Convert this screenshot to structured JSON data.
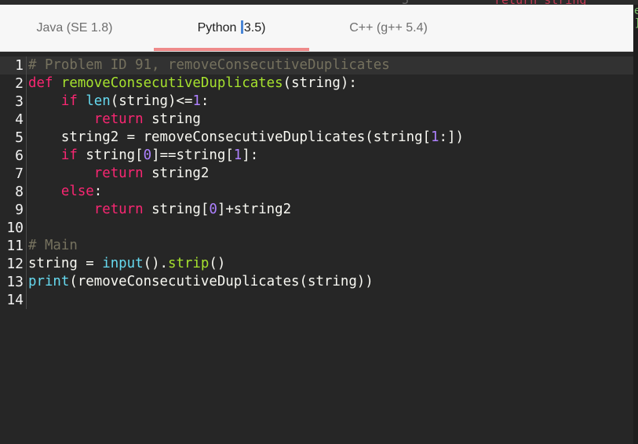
{
  "background_window": {
    "line_number": "5",
    "code_fragment": "return string",
    "right_chars": [
      "e",
      "]",
      "",
      "",
      "",
      "",
      "",
      "",
      "",
      ""
    ]
  },
  "tabs": [
    {
      "label": "Java (SE 1.8)",
      "active": false
    },
    {
      "label_before": "Python ",
      "label_after": "3.5)",
      "active": true
    },
    {
      "label": "C++ (g++ 5.4)",
      "active": false
    }
  ],
  "editor": {
    "lines": [
      {
        "num": "1",
        "tokens": [
          {
            "t": "# Problem ID 91, removeConsecutiveDuplicates",
            "c": "cm"
          }
        ]
      },
      {
        "num": "2",
        "tokens": [
          {
            "t": "def ",
            "c": "kw"
          },
          {
            "t": "removeConsecutiveDuplicates",
            "c": "fn"
          },
          {
            "t": "(string):",
            "c": "pl"
          }
        ]
      },
      {
        "num": "3",
        "tokens": [
          {
            "t": "    ",
            "c": "pl"
          },
          {
            "t": "if ",
            "c": "kw"
          },
          {
            "t": "len",
            "c": "bi"
          },
          {
            "t": "(string)<=",
            "c": "pl"
          },
          {
            "t": "1",
            "c": "num"
          },
          {
            "t": ":",
            "c": "pl"
          }
        ]
      },
      {
        "num": "4",
        "tokens": [
          {
            "t": "        ",
            "c": "pl"
          },
          {
            "t": "return ",
            "c": "kw"
          },
          {
            "t": "string",
            "c": "pl"
          }
        ]
      },
      {
        "num": "5",
        "tokens": [
          {
            "t": "    string2 = removeConsecutiveDuplicates(string[",
            "c": "pl"
          },
          {
            "t": "1",
            "c": "num"
          },
          {
            "t": ":])",
            "c": "pl"
          }
        ]
      },
      {
        "num": "6",
        "tokens": [
          {
            "t": "    ",
            "c": "pl"
          },
          {
            "t": "if ",
            "c": "kw"
          },
          {
            "t": "string[",
            "c": "pl"
          },
          {
            "t": "0",
            "c": "num"
          },
          {
            "t": "]==string[",
            "c": "pl"
          },
          {
            "t": "1",
            "c": "num"
          },
          {
            "t": "]:",
            "c": "pl"
          }
        ]
      },
      {
        "num": "7",
        "tokens": [
          {
            "t": "        ",
            "c": "pl"
          },
          {
            "t": "return ",
            "c": "kw"
          },
          {
            "t": "string2",
            "c": "pl"
          }
        ]
      },
      {
        "num": "8",
        "tokens": [
          {
            "t": "    ",
            "c": "pl"
          },
          {
            "t": "else",
            "c": "kw"
          },
          {
            "t": ":",
            "c": "pl"
          }
        ]
      },
      {
        "num": "9",
        "tokens": [
          {
            "t": "        ",
            "c": "pl"
          },
          {
            "t": "return ",
            "c": "kw"
          },
          {
            "t": "string[",
            "c": "pl"
          },
          {
            "t": "0",
            "c": "num"
          },
          {
            "t": "]+string2",
            "c": "pl"
          }
        ]
      },
      {
        "num": "10",
        "tokens": []
      },
      {
        "num": "11",
        "tokens": [
          {
            "t": "# Main",
            "c": "cm"
          }
        ]
      },
      {
        "num": "12",
        "tokens": [
          {
            "t": "string = ",
            "c": "pl"
          },
          {
            "t": "input",
            "c": "bi"
          },
          {
            "t": "().",
            "c": "pl"
          },
          {
            "t": "strip",
            "c": "fn"
          },
          {
            "t": "()",
            "c": "pl"
          }
        ]
      },
      {
        "num": "13",
        "tokens": [
          {
            "t": "print",
            "c": "bi"
          },
          {
            "t": "(removeConsecutiveDuplicates(string))",
            "c": "pl"
          }
        ]
      },
      {
        "num": "14",
        "tokens": []
      }
    ]
  }
}
